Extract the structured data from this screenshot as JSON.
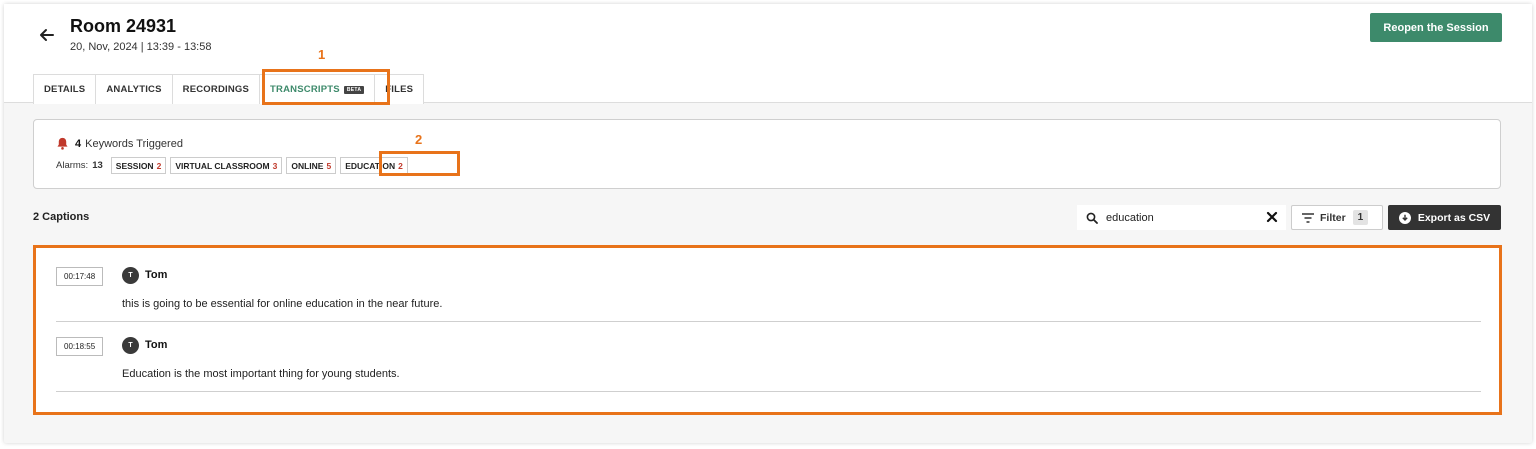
{
  "header": {
    "title": "Room 24931",
    "date": "20, Nov, 2024 | 13:39 - 13:58",
    "reopen_label": "Reopen the Session"
  },
  "tabs": [
    {
      "label": "DETAILS"
    },
    {
      "label": "ANALYTICS"
    },
    {
      "label": "RECORDINGS"
    },
    {
      "label": "TRANSCRIPTS",
      "badge": "BETA",
      "active": true
    },
    {
      "label": "FILES"
    }
  ],
  "annotations": {
    "one": "1",
    "two": "2"
  },
  "keywords": {
    "count": "4",
    "label": "Keywords Triggered",
    "alarms_label": "Alarms:",
    "alarms_count": "13",
    "chips": [
      {
        "name": "SESSION",
        "count": "2"
      },
      {
        "name": "VIRTUAL CLASSROOM",
        "count": "3"
      },
      {
        "name": "ONLINE",
        "count": "5"
      },
      {
        "name": "EDUCATION",
        "count": "2"
      }
    ]
  },
  "captions_header": {
    "title": "2 Captions",
    "search_value": "education",
    "filter_label": "Filter",
    "filter_count": "1",
    "export_label": "Export as CSV"
  },
  "captions": [
    {
      "time": "00:17:48",
      "initial": "T",
      "speaker": "Tom",
      "text": "this is going to be essential for online education in the near future."
    },
    {
      "time": "00:18:55",
      "initial": "T",
      "speaker": "Tom",
      "text": "Education is the most important thing for young students."
    }
  ],
  "colors": {
    "accent": "#3d8a6b",
    "annotation": "#e8731a",
    "keyword_count": "#c0392b"
  }
}
